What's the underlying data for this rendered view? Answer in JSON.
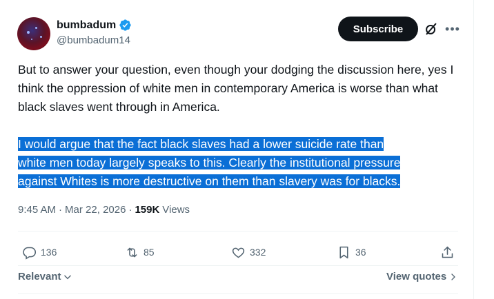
{
  "author": {
    "display_name": "bumbadum",
    "handle": "@bumbadum14",
    "verified": true,
    "verified_color": "#1d9bf0"
  },
  "header": {
    "subscribe_label": "Subscribe",
    "grok_icon": "grok-icon",
    "more_icon": "more-dots-icon"
  },
  "tweet": {
    "paragraph_1": "But to answer your question, even though your dodging the discussion here, yes I think the oppression of white men in contemporary America is worse than what black slaves went through in America.",
    "paragraph_2_lines": [
      "I would argue that the fact black slaves had a lower suicide rate than",
      "white men today largely speaks to this. Clearly the institutional pressure",
      "against Whites is more destructive on them than slavery was for blacks."
    ],
    "selection_color": "#0b6fd6"
  },
  "meta": {
    "time": "9:45 AM",
    "dot": "·",
    "date": "Mar 22, 2026",
    "views_count": "159K",
    "views_label": "Views"
  },
  "actions": {
    "replies": "136",
    "reposts": "85",
    "likes": "332",
    "bookmarks": "36"
  },
  "footer": {
    "relevant_label": "Relevant",
    "view_quotes_label": "View quotes"
  }
}
